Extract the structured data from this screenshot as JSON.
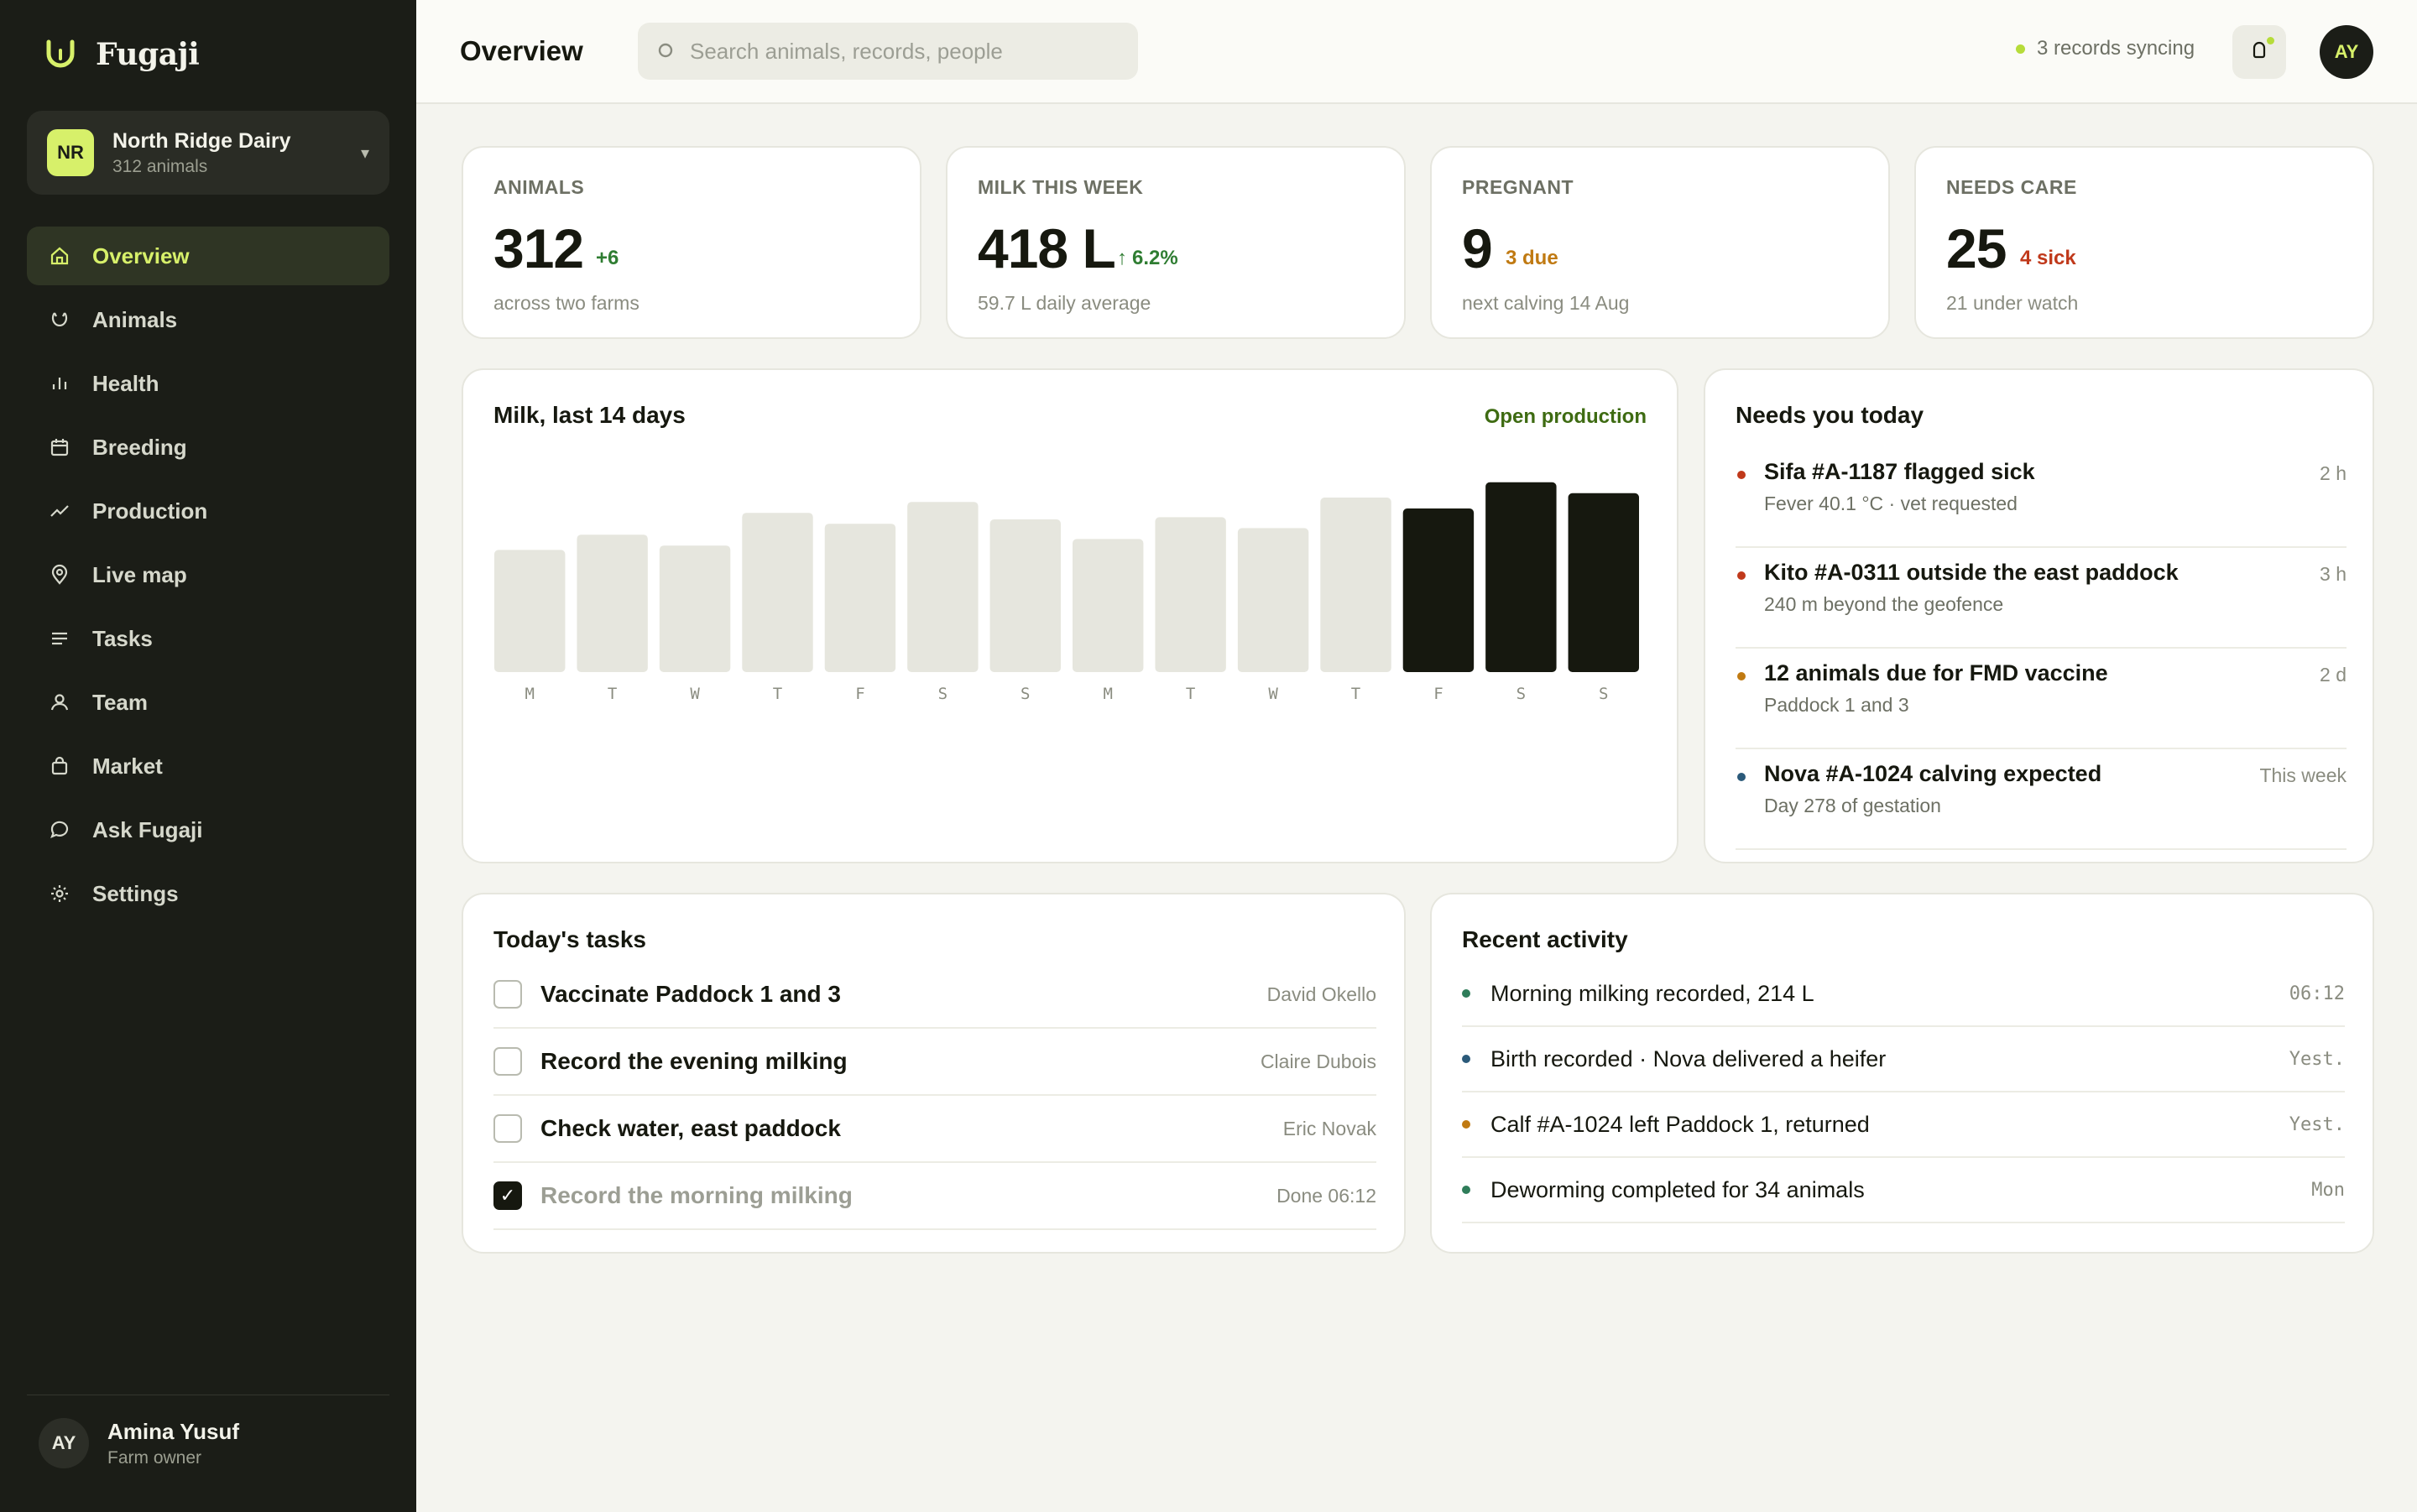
{
  "app": {
    "name": "Fugaji"
  },
  "farm": {
    "badge": "NR",
    "name": "North Ridge Dairy",
    "sub": "312 animals",
    "caret": "▾"
  },
  "nav": [
    {
      "label": "Overview",
      "icon": "home-icon"
    },
    {
      "label": "Animals",
      "icon": "cow-icon"
    },
    {
      "label": "Health",
      "icon": "bar-chart-icon"
    },
    {
      "label": "Breeding",
      "icon": "calendar-icon"
    },
    {
      "label": "Production",
      "icon": "trend-line-icon"
    },
    {
      "label": "Live map",
      "icon": "map-pin-icon"
    },
    {
      "label": "Tasks",
      "icon": "list-icon"
    },
    {
      "label": "Team",
      "icon": "person-icon"
    },
    {
      "label": "Market",
      "icon": "bag-icon"
    },
    {
      "label": "Ask Fugaji",
      "icon": "chat-bubble-icon"
    },
    {
      "label": "Settings",
      "icon": "gear-icon"
    }
  ],
  "user": {
    "initials": "AY",
    "name": "Amina Yusuf",
    "role": "Farm owner"
  },
  "topbar": {
    "title": "Overview",
    "search_placeholder": "Search animals, records, people",
    "sync_text": "3 records syncing",
    "avatar_initials": "AY"
  },
  "stats": [
    {
      "label": "ANIMALS",
      "value": "312",
      "delta": "+6",
      "sub": "across two farms"
    },
    {
      "label": "MILK THIS WEEK",
      "value": "418 L",
      "delta": "6.2%",
      "sub": "59.7 L daily average"
    },
    {
      "label": "PREGNANT",
      "value": "9",
      "delta": "3 due",
      "sub": "next calving 14 Aug"
    },
    {
      "label": "NEEDS CARE",
      "value": "25",
      "delta": "4 sick",
      "sub": "21 under watch"
    }
  ],
  "colors": {
    "green": "#2f7d32",
    "amber": "#c07a12",
    "red": "#c0391b",
    "blue": "#2b5a7a",
    "teal": "#2f7d5a",
    "lime": "#d7f06a"
  },
  "milk_card": {
    "title": "Milk, last 14 days",
    "link": "Open production"
  },
  "chart_data": {
    "type": "bar",
    "title": "Milk, last 14 days",
    "categories": [
      "M",
      "T",
      "W",
      "T",
      "F",
      "S",
      "S",
      "M",
      "T",
      "W",
      "T",
      "F",
      "S",
      "S"
    ],
    "values": [
      56,
      63,
      58,
      73,
      68,
      78,
      70,
      61,
      71,
      66,
      80,
      75,
      87,
      82
    ],
    "highlight_last": 3,
    "ylim": [
      0,
      100
    ],
    "grid": false,
    "colors": {
      "bar": "#e6e6de",
      "highlight": "#16180f"
    }
  },
  "needs": {
    "title": "Needs you today",
    "items": [
      {
        "title": "Sifa #A-1187 flagged sick",
        "sub": "Fever 40.1 °C · vet requested",
        "time": "2 h",
        "color": "#c0391b"
      },
      {
        "title": "Kito #A-0311 outside the east paddock",
        "sub": "240 m beyond the geofence",
        "time": "3 h",
        "color": "#c0391b"
      },
      {
        "title": "12 animals due for FMD vaccine",
        "sub": "Paddock 1 and 3",
        "time": "2 d",
        "color": "#c07a12"
      },
      {
        "title": "Nova #A-1024 calving expected",
        "sub": "Day 278 of gestation",
        "time": "This week",
        "color": "#2b5a7a"
      }
    ]
  },
  "tasks": {
    "title": "Today's tasks",
    "items": [
      {
        "label": "Vaccinate Paddock 1 and 3",
        "who": "David Okello",
        "done": false
      },
      {
        "label": "Record the evening milking",
        "who": "Claire Dubois",
        "done": false
      },
      {
        "label": "Check water, east paddock",
        "who": "Eric Novak",
        "done": false
      },
      {
        "label": "Record the morning milking",
        "who": "Done 06:12",
        "done": true
      }
    ]
  },
  "activity": {
    "title": "Recent activity",
    "items": [
      {
        "text": "Morning milking recorded, 214 L",
        "time": "06:12",
        "color": "#2f7d5a"
      },
      {
        "text": "Birth recorded · Nova delivered a heifer",
        "time": "Yest.",
        "color": "#2b5a7a"
      },
      {
        "text": "Calf #A-1024 left Paddock 1, returned",
        "time": "Yest.",
        "color": "#c07a12"
      },
      {
        "text": "Deworming completed for 34 animals",
        "time": "Mon",
        "color": "#2f7d5a"
      }
    ]
  }
}
